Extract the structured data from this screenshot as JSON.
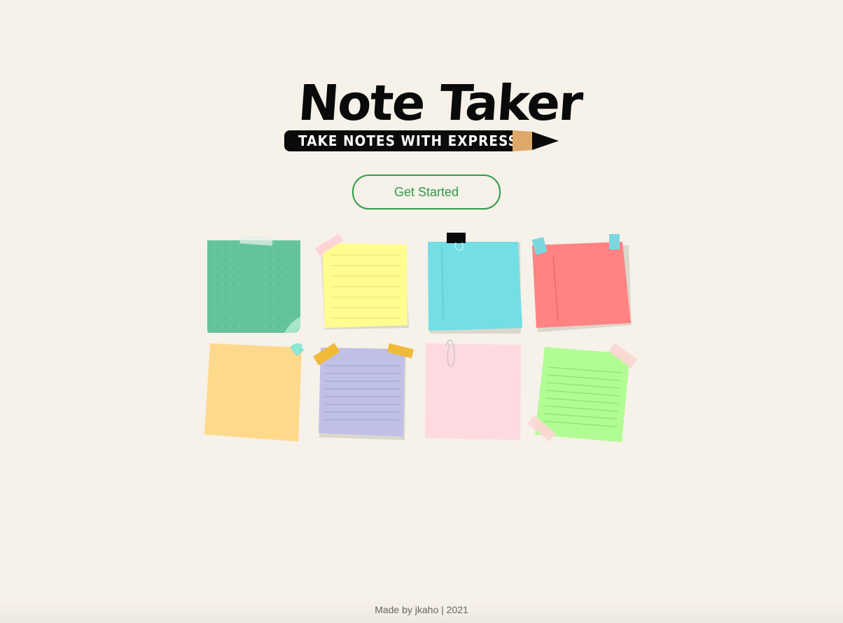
{
  "logo": {
    "title": "Note Taker",
    "tagline": "TAKE NOTES WITH EXPRESS"
  },
  "actions": {
    "get_started_label": "Get Started"
  },
  "footer": {
    "text": "Made by jkaho | 2021"
  },
  "colors": {
    "background": "#f6f1e9",
    "accent": "#2e9b48",
    "note_green": "#63c49b",
    "note_yellow": "#fffd8f",
    "note_cyan": "#73dfe4",
    "note_red": "#ff8382",
    "note_orange": "#ffd98b",
    "note_purple": "#c0c0e6",
    "note_pink": "#ffd9e0",
    "note_lime": "#b1fd94"
  }
}
